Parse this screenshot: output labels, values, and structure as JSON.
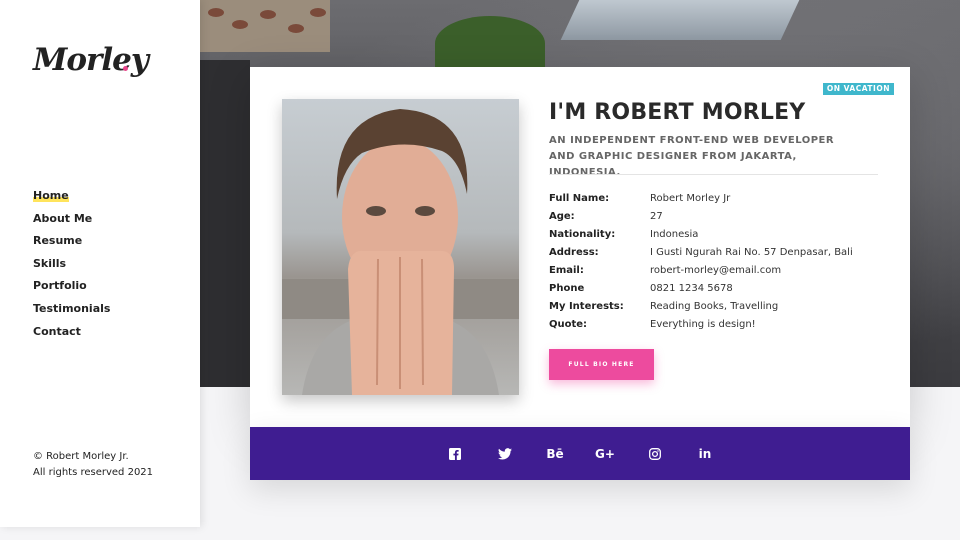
{
  "brand": {
    "logo_text": "Morley",
    "dot_color": "#e8458b"
  },
  "nav": {
    "items": [
      {
        "label": "Home",
        "active": true
      },
      {
        "label": "About Me"
      },
      {
        "label": "Resume"
      },
      {
        "label": "Skills"
      },
      {
        "label": "Portfolio"
      },
      {
        "label": "Testimonials"
      },
      {
        "label": "Contact"
      }
    ]
  },
  "footer": {
    "line1": "© Robert Morley Jr.",
    "line2": "All rights reserved 2021"
  },
  "profile": {
    "badge": "ON VACATION",
    "badge_color": "#3fb7cc",
    "title": "I'M ROBERT MORLEY",
    "subtitle": "AN INDEPENDENT FRONT-END WEB DEVELOPER AND GRAPHIC DESIGNER FROM JAKARTA, INDONESIA.",
    "info": [
      {
        "label": "Full Name:",
        "value": "Robert Morley Jr"
      },
      {
        "label": "Age:",
        "value": "27"
      },
      {
        "label": "Nationality:",
        "value": "Indonesia"
      },
      {
        "label": "Address:",
        "value": "I Gusti Ngurah Rai No. 57 Denpasar, Bali"
      },
      {
        "label": "Email:",
        "value": "robert-morley@email.com"
      },
      {
        "label": "Phone",
        "value": "0821 1234 5678"
      },
      {
        "label": "My Interests:",
        "value": "Reading Books, Travelling"
      },
      {
        "label": "Quote:",
        "value": "Everything is design!"
      }
    ],
    "button_label": "FULL BIO HERE",
    "button_color": "#ed4b9e"
  },
  "social": {
    "bar_color": "#3f1d91",
    "icons": [
      {
        "name": "facebook-icon",
        "glyph": "f"
      },
      {
        "name": "twitter-icon",
        "glyph": ""
      },
      {
        "name": "behance-icon",
        "glyph": "Bē"
      },
      {
        "name": "google-plus-icon",
        "glyph": "G+"
      },
      {
        "name": "instagram-icon",
        "glyph": ""
      },
      {
        "name": "linkedin-icon",
        "glyph": "in"
      }
    ]
  }
}
